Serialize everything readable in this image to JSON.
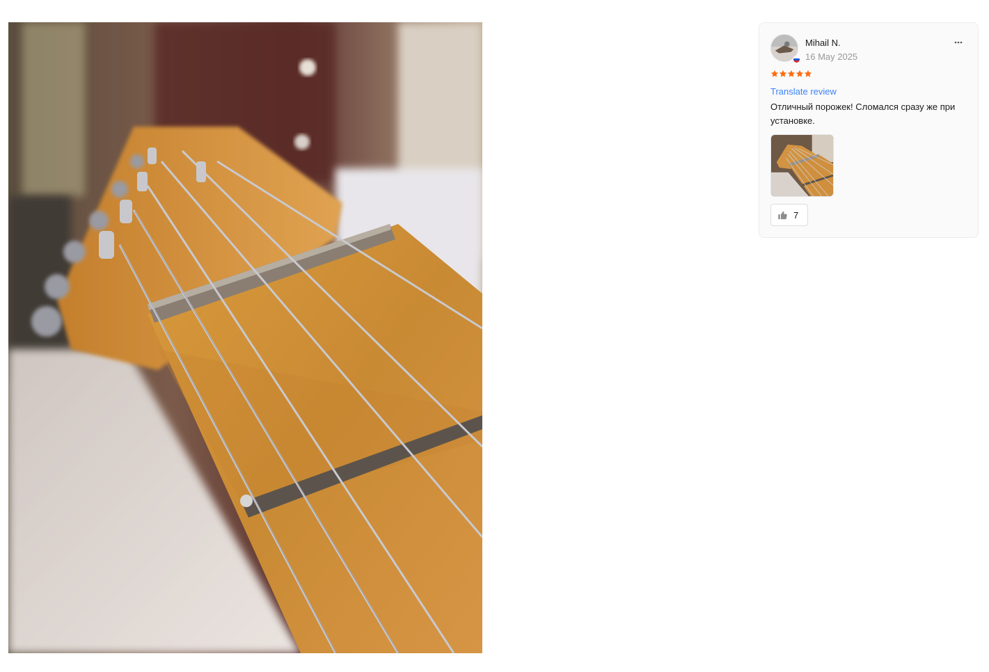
{
  "photo_viewer": {
    "image_name": "guitar-headstock-nut-photo"
  },
  "review": {
    "reviewer_name": "Mihail N.",
    "date": "16 May 2025",
    "country_flag": "russia-flag-icon",
    "rating": 5,
    "rating_max": 5,
    "star_color": "#fd6c10",
    "translate_label": "Translate review",
    "translate_color": "#3c82f6",
    "text": "Отличный порожек! Сломался сразу же при установке.",
    "more_icon": "more-dots-icon",
    "attachments_count": 1,
    "helpful": {
      "icon": "thumbs-up-icon",
      "count": "7"
    }
  }
}
